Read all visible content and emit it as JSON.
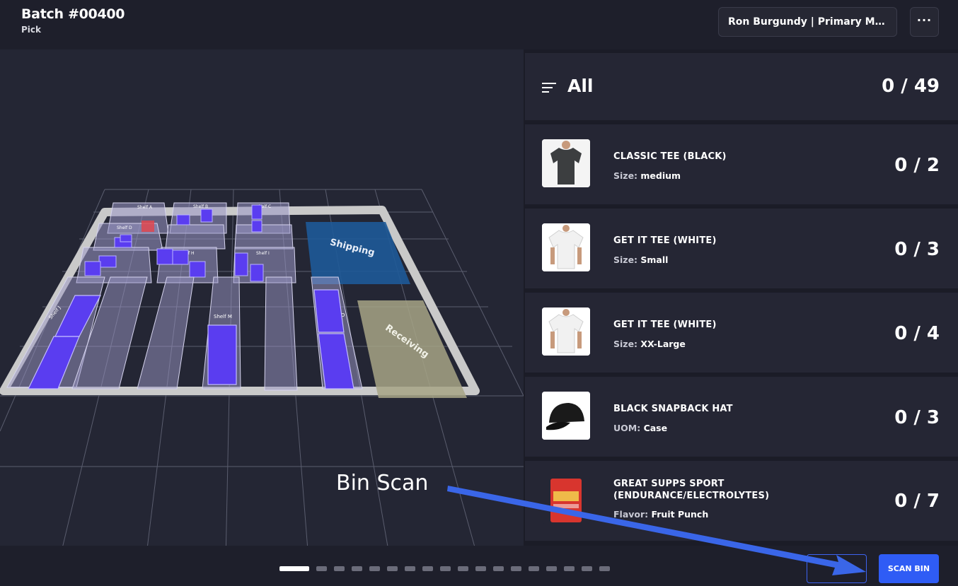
{
  "header": {
    "title": "Batch #00400",
    "subtitle": "Pick",
    "user_select": "Ron Burgundy | Primary Main",
    "more_label": "···"
  },
  "map": {
    "shelf_labels": [
      "Shelf A",
      "Shelf B",
      "Shelf C",
      "Shelf D",
      "Shelf H",
      "Shelf I",
      "Shelf J",
      "Shelf M",
      "Shelf O"
    ],
    "zones": [
      "Shipping",
      "Receiving"
    ]
  },
  "summary": {
    "label": "All",
    "count": "0 / 49"
  },
  "items": [
    {
      "name": "CLASSIC TEE (BLACK)",
      "attr_key": "Size:",
      "attr_val": "medium",
      "count": "0 / 2",
      "thumb": "black-tshirt"
    },
    {
      "name": "GET IT TEE (WHITE)",
      "attr_key": "Size:",
      "attr_val": "Small",
      "count": "0 / 3",
      "thumb": "white-tshirt"
    },
    {
      "name": "GET IT TEE (WHITE)",
      "attr_key": "Size:",
      "attr_val": "XX-Large",
      "count": "0 / 4",
      "thumb": "white-tshirt"
    },
    {
      "name": "BLACK SNAPBACK HAT",
      "attr_key": "UOM:",
      "attr_val": "Case",
      "count": "0 / 3",
      "thumb": "black-cap"
    },
    {
      "name": "GREAT SUPPS SPORT (ENDURANCE/ELECTROLYTES)",
      "attr_key": "Flavor:",
      "attr_val": "Fruit Punch",
      "count": "0 / 7",
      "thumb": "red-bag"
    }
  ],
  "footer": {
    "scan_label": "SCAN BIN"
  },
  "annotation": {
    "label": "Bin Scan",
    "color": "#3a66e8"
  },
  "colors": {
    "accent": "#2f5cf5",
    "bin": "#5a3df0",
    "highlight_bin": "#e0464f"
  }
}
